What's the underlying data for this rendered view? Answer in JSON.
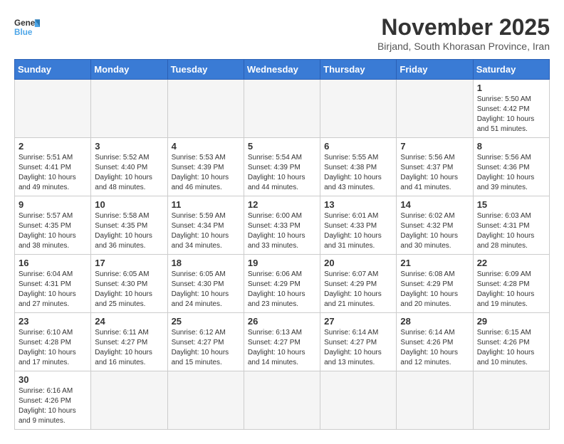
{
  "logo": {
    "text_general": "General",
    "text_blue": "Blue"
  },
  "title": "November 2025",
  "subtitle": "Birjand, South Khorasan Province, Iran",
  "weekdays": [
    "Sunday",
    "Monday",
    "Tuesday",
    "Wednesday",
    "Thursday",
    "Friday",
    "Saturday"
  ],
  "days": [
    {
      "num": "",
      "info": "",
      "empty": true
    },
    {
      "num": "",
      "info": "",
      "empty": true
    },
    {
      "num": "",
      "info": "",
      "empty": true
    },
    {
      "num": "",
      "info": "",
      "empty": true
    },
    {
      "num": "",
      "info": "",
      "empty": true
    },
    {
      "num": "",
      "info": "",
      "empty": true
    },
    {
      "num": "1",
      "info": "Sunrise: 5:50 AM\nSunset: 4:42 PM\nDaylight: 10 hours\nand 51 minutes."
    },
    {
      "num": "2",
      "info": "Sunrise: 5:51 AM\nSunset: 4:41 PM\nDaylight: 10 hours\nand 49 minutes."
    },
    {
      "num": "3",
      "info": "Sunrise: 5:52 AM\nSunset: 4:40 PM\nDaylight: 10 hours\nand 48 minutes."
    },
    {
      "num": "4",
      "info": "Sunrise: 5:53 AM\nSunset: 4:39 PM\nDaylight: 10 hours\nand 46 minutes."
    },
    {
      "num": "5",
      "info": "Sunrise: 5:54 AM\nSunset: 4:39 PM\nDaylight: 10 hours\nand 44 minutes."
    },
    {
      "num": "6",
      "info": "Sunrise: 5:55 AM\nSunset: 4:38 PM\nDaylight: 10 hours\nand 43 minutes."
    },
    {
      "num": "7",
      "info": "Sunrise: 5:56 AM\nSunset: 4:37 PM\nDaylight: 10 hours\nand 41 minutes."
    },
    {
      "num": "8",
      "info": "Sunrise: 5:56 AM\nSunset: 4:36 PM\nDaylight: 10 hours\nand 39 minutes."
    },
    {
      "num": "9",
      "info": "Sunrise: 5:57 AM\nSunset: 4:35 PM\nDaylight: 10 hours\nand 38 minutes."
    },
    {
      "num": "10",
      "info": "Sunrise: 5:58 AM\nSunset: 4:35 PM\nDaylight: 10 hours\nand 36 minutes."
    },
    {
      "num": "11",
      "info": "Sunrise: 5:59 AM\nSunset: 4:34 PM\nDaylight: 10 hours\nand 34 minutes."
    },
    {
      "num": "12",
      "info": "Sunrise: 6:00 AM\nSunset: 4:33 PM\nDaylight: 10 hours\nand 33 minutes."
    },
    {
      "num": "13",
      "info": "Sunrise: 6:01 AM\nSunset: 4:33 PM\nDaylight: 10 hours\nand 31 minutes."
    },
    {
      "num": "14",
      "info": "Sunrise: 6:02 AM\nSunset: 4:32 PM\nDaylight: 10 hours\nand 30 minutes."
    },
    {
      "num": "15",
      "info": "Sunrise: 6:03 AM\nSunset: 4:31 PM\nDaylight: 10 hours\nand 28 minutes."
    },
    {
      "num": "16",
      "info": "Sunrise: 6:04 AM\nSunset: 4:31 PM\nDaylight: 10 hours\nand 27 minutes."
    },
    {
      "num": "17",
      "info": "Sunrise: 6:05 AM\nSunset: 4:30 PM\nDaylight: 10 hours\nand 25 minutes."
    },
    {
      "num": "18",
      "info": "Sunrise: 6:05 AM\nSunset: 4:30 PM\nDaylight: 10 hours\nand 24 minutes."
    },
    {
      "num": "19",
      "info": "Sunrise: 6:06 AM\nSunset: 4:29 PM\nDaylight: 10 hours\nand 23 minutes."
    },
    {
      "num": "20",
      "info": "Sunrise: 6:07 AM\nSunset: 4:29 PM\nDaylight: 10 hours\nand 21 minutes."
    },
    {
      "num": "21",
      "info": "Sunrise: 6:08 AM\nSunset: 4:29 PM\nDaylight: 10 hours\nand 20 minutes."
    },
    {
      "num": "22",
      "info": "Sunrise: 6:09 AM\nSunset: 4:28 PM\nDaylight: 10 hours\nand 19 minutes."
    },
    {
      "num": "23",
      "info": "Sunrise: 6:10 AM\nSunset: 4:28 PM\nDaylight: 10 hours\nand 17 minutes."
    },
    {
      "num": "24",
      "info": "Sunrise: 6:11 AM\nSunset: 4:27 PM\nDaylight: 10 hours\nand 16 minutes."
    },
    {
      "num": "25",
      "info": "Sunrise: 6:12 AM\nSunset: 4:27 PM\nDaylight: 10 hours\nand 15 minutes."
    },
    {
      "num": "26",
      "info": "Sunrise: 6:13 AM\nSunset: 4:27 PM\nDaylight: 10 hours\nand 14 minutes."
    },
    {
      "num": "27",
      "info": "Sunrise: 6:14 AM\nSunset: 4:27 PM\nDaylight: 10 hours\nand 13 minutes."
    },
    {
      "num": "28",
      "info": "Sunrise: 6:14 AM\nSunset: 4:26 PM\nDaylight: 10 hours\nand 12 minutes."
    },
    {
      "num": "29",
      "info": "Sunrise: 6:15 AM\nSunset: 4:26 PM\nDaylight: 10 hours\nand 10 minutes."
    },
    {
      "num": "30",
      "info": "Sunrise: 6:16 AM\nSunset: 4:26 PM\nDaylight: 10 hours\nand 9 minutes."
    },
    {
      "num": "",
      "info": "",
      "empty": true
    },
    {
      "num": "",
      "info": "",
      "empty": true
    },
    {
      "num": "",
      "info": "",
      "empty": true
    },
    {
      "num": "",
      "info": "",
      "empty": true
    },
    {
      "num": "",
      "info": "",
      "empty": true
    },
    {
      "num": "",
      "info": "",
      "empty": true
    }
  ]
}
